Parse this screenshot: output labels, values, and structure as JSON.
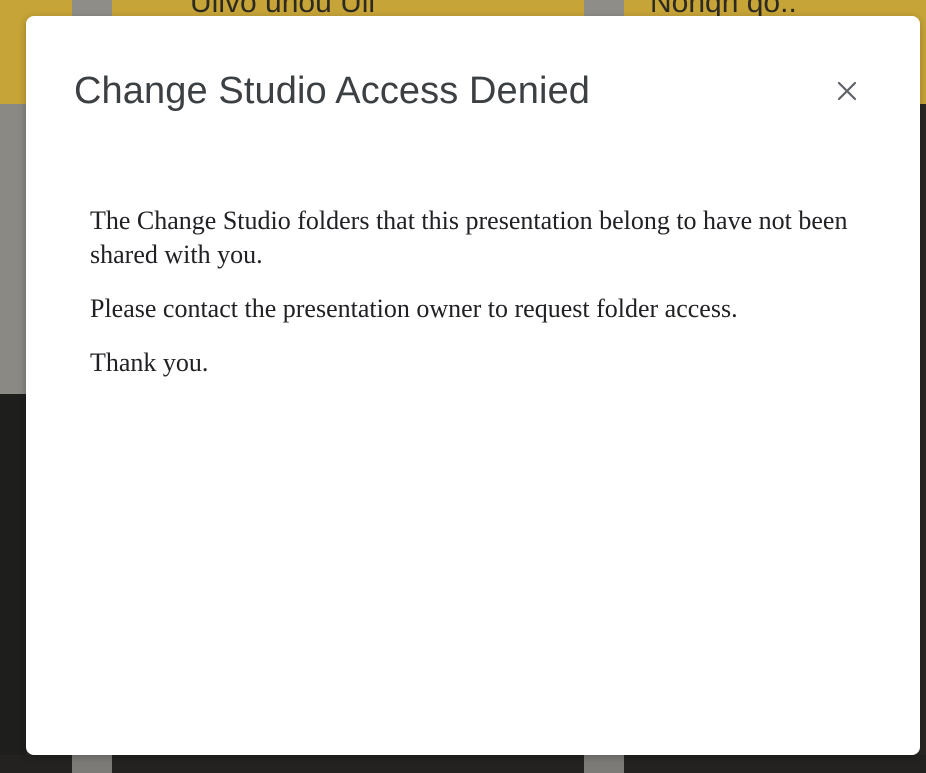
{
  "backdrop": {
    "text_left": "Ulivo unou Ull",
    "text_right": "Nonqn qo.."
  },
  "dialog": {
    "title": "Change Studio Access Denied",
    "close_icon": "close-icon",
    "paragraphs": [
      "The Change Studio folders that this presentation belong to have not been shared with you.",
      "Please contact the presentation owner to request folder access.",
      "Thank you."
    ]
  },
  "colors": {
    "backdrop_gold": "#c6a437",
    "title_text": "#3c4043",
    "body_text": "#202124",
    "close_icon": "#5f6368",
    "dialog_background": "#ffffff"
  }
}
